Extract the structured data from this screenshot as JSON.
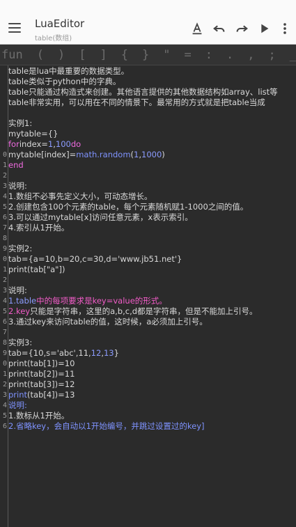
{
  "appbar": {
    "title": "LuaEditor",
    "subtitle": "table(数组)",
    "icons": [
      "menu-icon",
      "format-text-icon",
      "undo-icon",
      "redo-icon",
      "play-icon",
      "more-vert-icon"
    ]
  },
  "symbols": [
    "fun",
    "(",
    ")",
    "[",
    "]",
    "{",
    "}",
    "\"",
    "=",
    ":",
    ".",
    ",",
    ";",
    "_"
  ],
  "colors": {
    "background": "#2b2b2b",
    "keyword": "#f06be0",
    "number": "#8c9cff",
    "function": "#7f93ff"
  },
  "lines": [
    {
      "n": "",
      "seg": [
        [
          "table是lua中最重要的数据类型。",
          ""
        ]
      ]
    },
    {
      "n": "",
      "seg": [
        [
          "table类似于python中的字典。",
          ""
        ]
      ]
    },
    {
      "n": "",
      "seg": [
        [
          "table只能通过构造式来创建。其他语言提供的其他数据结构如array、list等",
          ""
        ]
      ]
    },
    {
      "n": "",
      "seg": [
        [
          "table非常实用，可以用在不同的情景下。最常用的方式就是把table当成",
          ""
        ]
      ]
    },
    {
      "n": "",
      "seg": [
        [
          "",
          ""
        ]
      ]
    },
    {
      "n": "",
      "seg": [
        [
          "实例1:",
          ""
        ]
      ]
    },
    {
      "n": "",
      "seg": [
        [
          "mytable={}",
          ""
        ]
      ]
    },
    {
      "n": "",
      "seg": [
        [
          "for",
          "kw"
        ],
        [
          "index=",
          ""
        ],
        [
          "1",
          "num"
        ],
        [
          ",",
          ""
        ],
        [
          "100",
          "num"
        ],
        [
          "do",
          "kw"
        ]
      ]
    },
    {
      "n": "0",
      "seg": [
        [
          "mytable[index]=",
          ""
        ],
        [
          "math.random",
          "fn"
        ],
        [
          "(",
          ""
        ],
        [
          "1",
          "num"
        ],
        [
          ",",
          ""
        ],
        [
          "1000",
          "num"
        ],
        [
          ")",
          ""
        ]
      ]
    },
    {
      "n": "1",
      "seg": [
        [
          "end",
          "kw"
        ]
      ]
    },
    {
      "n": "2",
      "seg": [
        [
          "",
          ""
        ]
      ]
    },
    {
      "n": "3",
      "seg": [
        [
          "说明:",
          ""
        ]
      ]
    },
    {
      "n": "4",
      "seg": [
        [
          "1.数组不必事先定义大小，可动态增长。",
          ""
        ]
      ]
    },
    {
      "n": "5",
      "seg": [
        [
          "2.创建包含100个元素的table，每个元素随机赋1-1000之间的值。",
          ""
        ]
      ]
    },
    {
      "n": "6",
      "seg": [
        [
          "3.可以通过mytable[x]访问任意元素，x表示索引。",
          ""
        ]
      ]
    },
    {
      "n": "7",
      "seg": [
        [
          "4.索引从1开始。",
          ""
        ]
      ]
    },
    {
      "n": "8",
      "seg": [
        [
          "",
          ""
        ]
      ]
    },
    {
      "n": "9",
      "seg": [
        [
          "实例2:",
          ""
        ]
      ]
    },
    {
      "n": "0",
      "seg": [
        [
          "tab={a=10,b=20,c=30,d='www.jb51.net'}",
          ""
        ]
      ]
    },
    {
      "n": "1",
      "seg": [
        [
          "print(tab[\"a\"])",
          ""
        ]
      ]
    },
    {
      "n": "2",
      "seg": [
        [
          "",
          ""
        ]
      ]
    },
    {
      "n": "3",
      "seg": [
        [
          "说明:",
          ""
        ]
      ]
    },
    {
      "n": "4",
      "seg": [
        [
          "1.table",
          "num"
        ],
        [
          "中的每项要求是key=value的形式。",
          "red"
        ]
      ]
    },
    {
      "n": "5",
      "seg": [
        [
          "2.key",
          "red"
        ],
        [
          "只能是字符串，这里的a,b,c,d都是字符串，但是不能加上引号。",
          ""
        ]
      ]
    },
    {
      "n": "6",
      "seg": [
        [
          "3.通过key来访问table的值，这时候，a必须加上引号。",
          ""
        ]
      ]
    },
    {
      "n": "7",
      "seg": [
        [
          "",
          ""
        ]
      ]
    },
    {
      "n": "8",
      "seg": [
        [
          "实例3:",
          ""
        ]
      ]
    },
    {
      "n": "9",
      "seg": [
        [
          "tab={10,s='abc',11,",
          ""
        ],
        [
          "12",
          "num"
        ],
        [
          ",",
          ""
        ],
        [
          "13",
          "num"
        ],
        [
          "}",
          ""
        ]
      ]
    },
    {
      "n": "0",
      "seg": [
        [
          "print(tab[1])=10",
          ""
        ]
      ]
    },
    {
      "n": "1",
      "seg": [
        [
          "print(tab[2])=11",
          ""
        ]
      ]
    },
    {
      "n": "2",
      "seg": [
        [
          "print(tab[3])=12",
          ""
        ]
      ]
    },
    {
      "n": "3",
      "seg": [
        [
          "print",
          "fn"
        ],
        [
          "(tab[4])=13",
          ""
        ]
      ]
    },
    {
      "n": "4",
      "seg": [
        [
          "说明:",
          "fn"
        ]
      ]
    },
    {
      "n": "5",
      "seg": [
        [
          "1.数标从1开始。",
          ""
        ]
      ]
    },
    {
      "n": "6",
      "seg": [
        [
          "2.省略key，会自动以1开始编号，并跳过设置过的key]",
          "fn"
        ]
      ]
    }
  ]
}
